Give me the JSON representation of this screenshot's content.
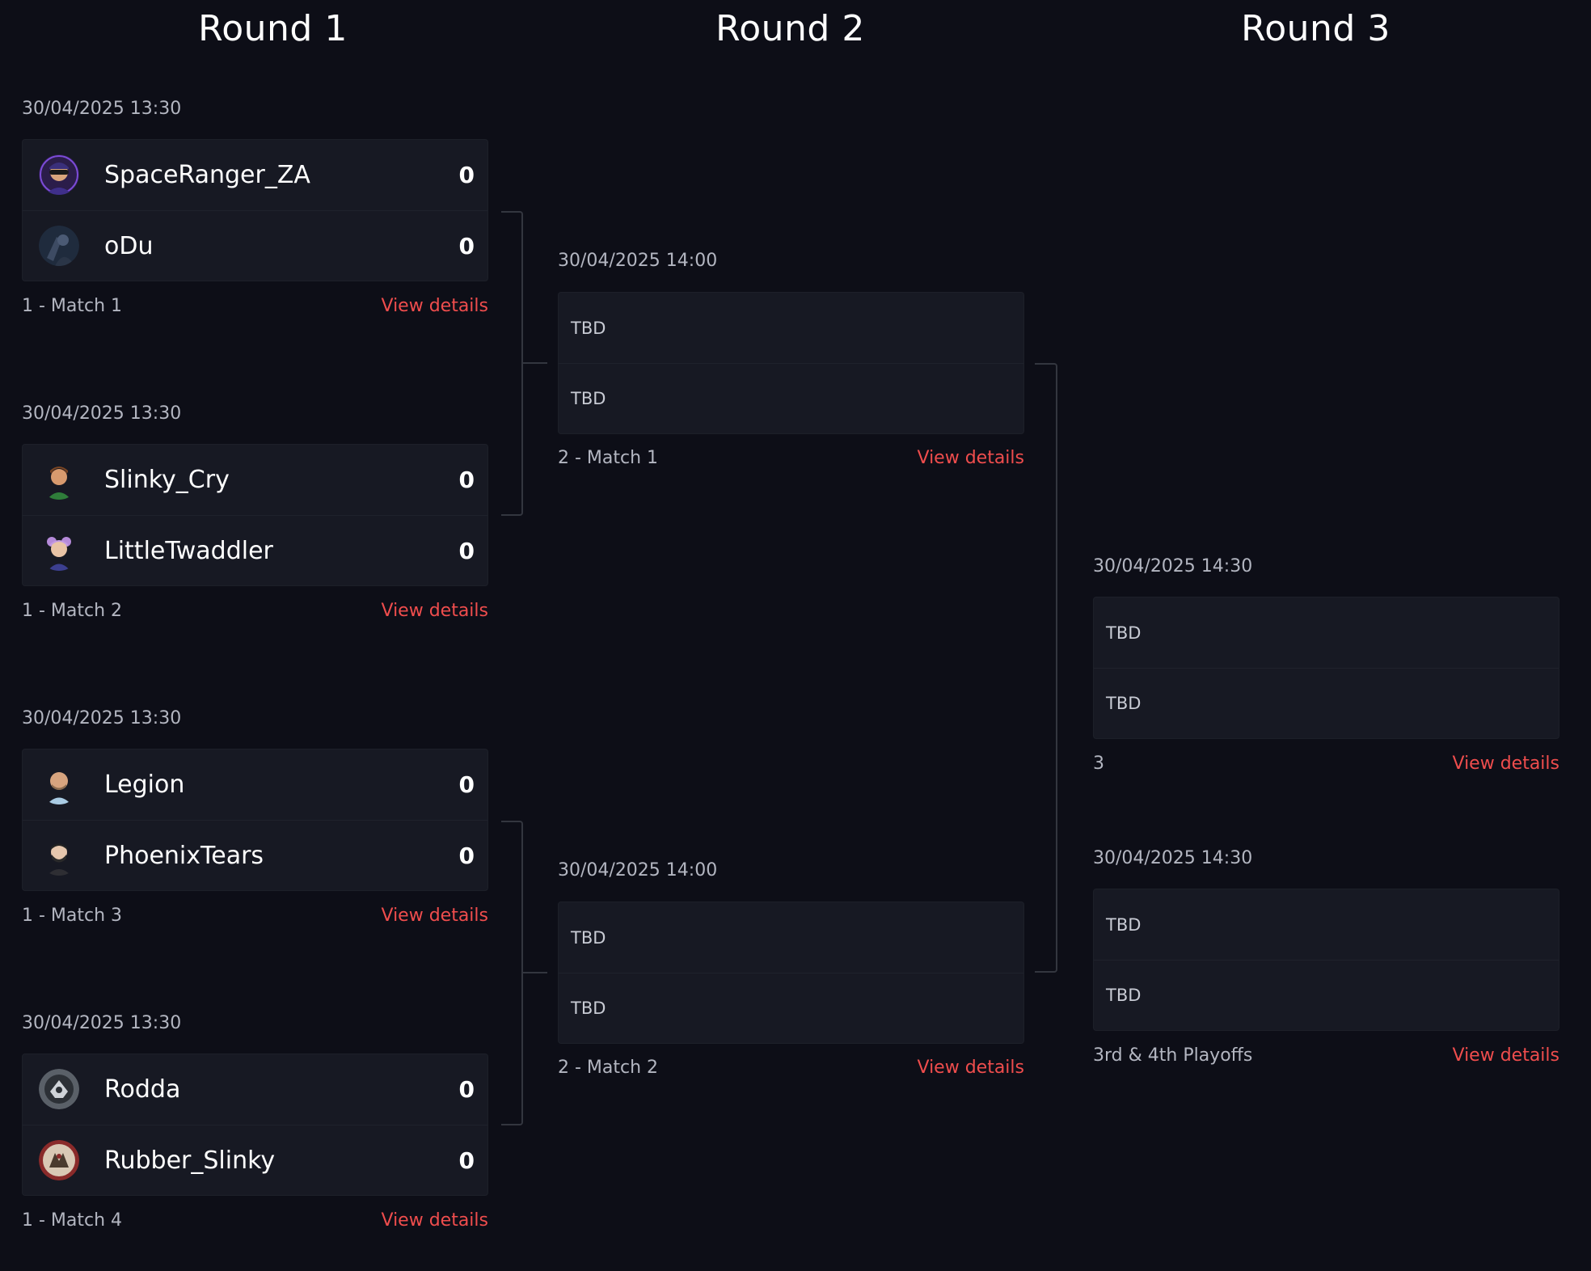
{
  "rounds": [
    {
      "title": "Round 1"
    },
    {
      "title": "Round 2"
    },
    {
      "title": "Round 3"
    }
  ],
  "view_details_label": "View details",
  "tbd_label": "TBD",
  "round1": [
    {
      "date": "30/04/2025 13:30",
      "label": "1 - Match 1",
      "players": [
        {
          "name": "SpaceRanger_ZA",
          "score": "0",
          "avatar": "helmet-avatar"
        },
        {
          "name": "oDu",
          "score": "0",
          "avatar": "soldier-avatar"
        }
      ]
    },
    {
      "date": "30/04/2025 13:30",
      "label": "1 - Match 2",
      "players": [
        {
          "name": "Slinky_Cry",
          "score": "0",
          "avatar": "green-shirt-avatar"
        },
        {
          "name": "LittleTwaddler",
          "score": "0",
          "avatar": "purple-hair-avatar"
        }
      ]
    },
    {
      "date": "30/04/2025 13:30",
      "label": "1 - Match 3",
      "players": [
        {
          "name": "Legion",
          "score": "0",
          "avatar": "bald-avatar"
        },
        {
          "name": "PhoenixTears",
          "score": "0",
          "avatar": "bearded-avatar"
        }
      ]
    },
    {
      "date": "30/04/2025 13:30",
      "label": "1 - Match 4",
      "players": [
        {
          "name": "Rodda",
          "score": "0",
          "avatar": "badge-avatar"
        },
        {
          "name": "Rubber_Slinky",
          "score": "0",
          "avatar": "team-logo-avatar"
        }
      ]
    }
  ],
  "round2": [
    {
      "date": "30/04/2025 14:00",
      "label": "2 - Match 1"
    },
    {
      "date": "30/04/2025 14:00",
      "label": "2 - Match 2"
    }
  ],
  "round3": [
    {
      "date": "30/04/2025 14:30",
      "label": "3"
    },
    {
      "date": "30/04/2025 14:30",
      "label": "3rd & 4th Playoffs"
    }
  ]
}
